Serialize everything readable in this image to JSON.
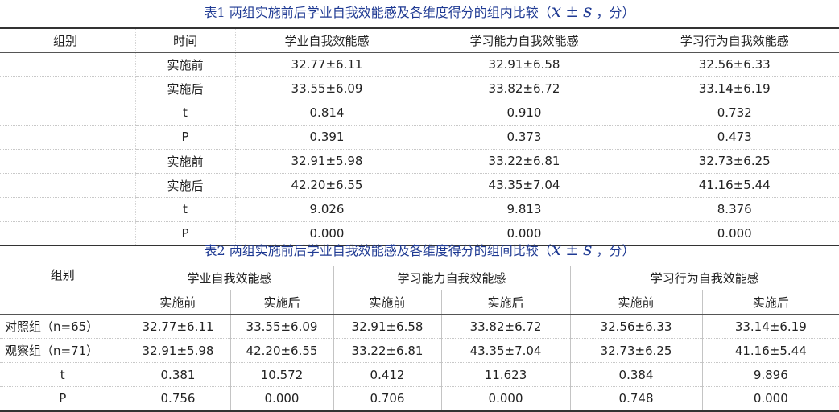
{
  "table1": {
    "caption_text": "表1 两组实施前后学业自我效能感及各维度得分的组内比较（",
    "caption_x": "x",
    "caption_pm": "±",
    "caption_s": "s",
    "caption_unit": "，分）",
    "headers": [
      "组别",
      "时间",
      "学业自我效能感",
      "学习能力自我效能感",
      "学习行为自我效能感"
    ],
    "rows": [
      [
        "",
        "实施前",
        "32.77±6.11",
        "32.91±6.58",
        "32.56±6.33"
      ],
      [
        "",
        "实施后",
        "33.55±6.09",
        "33.82±6.72",
        "33.14±6.19"
      ],
      [
        "",
        "t",
        "0.814",
        "0.910",
        "0.732"
      ],
      [
        "",
        "P",
        "0.391",
        "0.373",
        "0.473"
      ],
      [
        "",
        "实施前",
        "32.91±5.98",
        "33.22±6.81",
        "32.73±6.25"
      ],
      [
        "",
        "实施后",
        "42.20±6.55",
        "43.35±7.04",
        "41.16±5.44"
      ],
      [
        "",
        "t",
        "9.026",
        "9.813",
        "8.376"
      ],
      [
        "",
        "P",
        "0.000",
        "0.000",
        "0.000"
      ]
    ]
  },
  "table2": {
    "caption_text": "表2 两组实施前后学业自我效能感及各维度得分的组间比较（",
    "caption_x": "x",
    "caption_pm": "±",
    "caption_s": "s",
    "caption_unit": "，分）",
    "group_header": "组别",
    "dimension_headers": [
      "学业自我效能感",
      "学习能力自我效能感",
      "学习行为自我效能感"
    ],
    "sub_headers": [
      "实施前",
      "实施后",
      "实施前",
      "实施后",
      "实施前",
      "实施后"
    ],
    "rows": [
      [
        "对照组（n=65）",
        "32.77±6.11",
        "33.55±6.09",
        "32.91±6.58",
        "33.82±6.72",
        "32.56±6.33",
        "33.14±6.19"
      ],
      [
        "观察组（n=71）",
        "32.91±5.98",
        "42.20±6.55",
        "33.22±6.81",
        "43.35±7.04",
        "32.73±6.25",
        "41.16±5.44"
      ],
      [
        "t",
        "0.381",
        "10.572",
        "0.412",
        "11.623",
        "0.384",
        "9.896"
      ],
      [
        "P",
        "0.756",
        "0.000",
        "0.706",
        "0.000",
        "0.748",
        "0.000"
      ]
    ]
  }
}
